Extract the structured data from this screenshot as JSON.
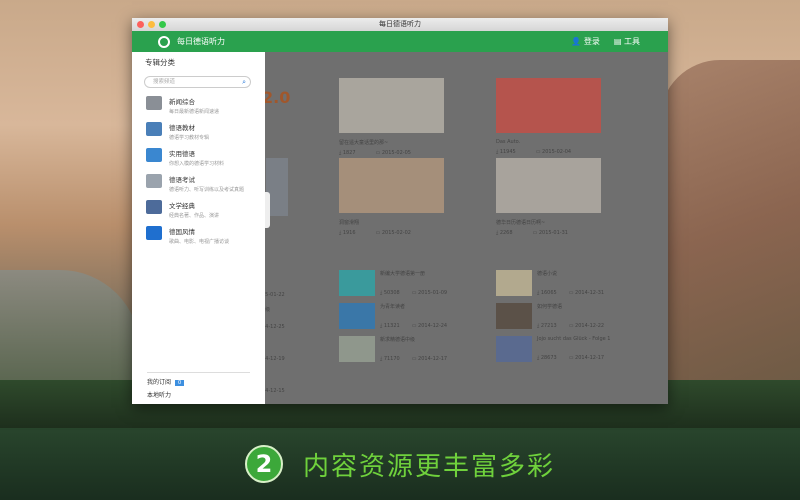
{
  "window": {
    "title": "每日德语听力"
  },
  "header": {
    "app_name": "每日德语听力",
    "login": "登录",
    "tools": "工具"
  },
  "sidebar": {
    "title": "专辑分类",
    "search_placeholder": "搜索频道",
    "items": [
      {
        "label": "新闻综合",
        "desc": "每日最新德语新闻速递",
        "color": "#8a8f96"
      },
      {
        "label": "德语教材",
        "desc": "德语学习教材专辑",
        "color": "#4a7fb8"
      },
      {
        "label": "实用德语",
        "desc": "你想入模的德语学习材料",
        "color": "#3a87d0"
      },
      {
        "label": "德语考试",
        "desc": "德语听力、听写训练以及考试真题",
        "color": "#9aa3ad"
      },
      {
        "label": "文学经典",
        "desc": "经典名著、作品、演讲",
        "color": "#4d6b9a"
      },
      {
        "label": "德国风情",
        "desc": "歌曲、电影、电视广播访谈",
        "color": "#1f6fcf"
      }
    ],
    "subscriptions": "我的订阅",
    "subscriptions_badge": "0",
    "local": "本地听力"
  },
  "main": {
    "partial_logo": "2.0",
    "cards": [
      {
        "caption": "留在遥大童话里的那~",
        "downloads": "1827",
        "date": "2015-02-05",
        "color": "#a9a59d"
      },
      {
        "caption": "Das Auto.",
        "downloads": "11945",
        "date": "2015-02-04",
        "color": "#b5544d"
      },
      {
        "caption": "洞窗滑翔",
        "downloads": "1916",
        "date": "2015-02-02",
        "color": "#a58f7a"
      },
      {
        "caption": "德华日历德语日历啊~",
        "downloads": "2268",
        "date": "2015-01-31",
        "color": "#a8a39c"
      }
    ],
    "list": [
      {
        "title": "新编大学德语第一册",
        "downloads": "50308",
        "date": "2015-01-09",
        "color": "#3a9a9c"
      },
      {
        "title": "德语小说",
        "downloads": "16065",
        "date": "2014-12-31",
        "color": "#b2a98e"
      },
      {
        "title": "为青年读者",
        "downloads": "11321",
        "date": "2014-12-24",
        "color": "#3a77a8"
      },
      {
        "title": "如何学德语",
        "downloads": "27213",
        "date": "2014-12-22",
        "color": "#5b5148"
      },
      {
        "title": "新求精德语中级",
        "downloads": "71170",
        "date": "2014-12-17",
        "color": "#8f978c"
      },
      {
        "title": "Jojo sucht das Glück - Folge 1",
        "downloads": "28673",
        "date": "2014-12-17",
        "color": "#5a6a8f"
      }
    ],
    "partial_dates": [
      "15-01-22",
      "14-12-25",
      "14-12-19",
      "14-12-15"
    ],
    "partial_text": "1级"
  },
  "banner": {
    "step": "2",
    "slogan": "内容资源更丰富多彩"
  }
}
